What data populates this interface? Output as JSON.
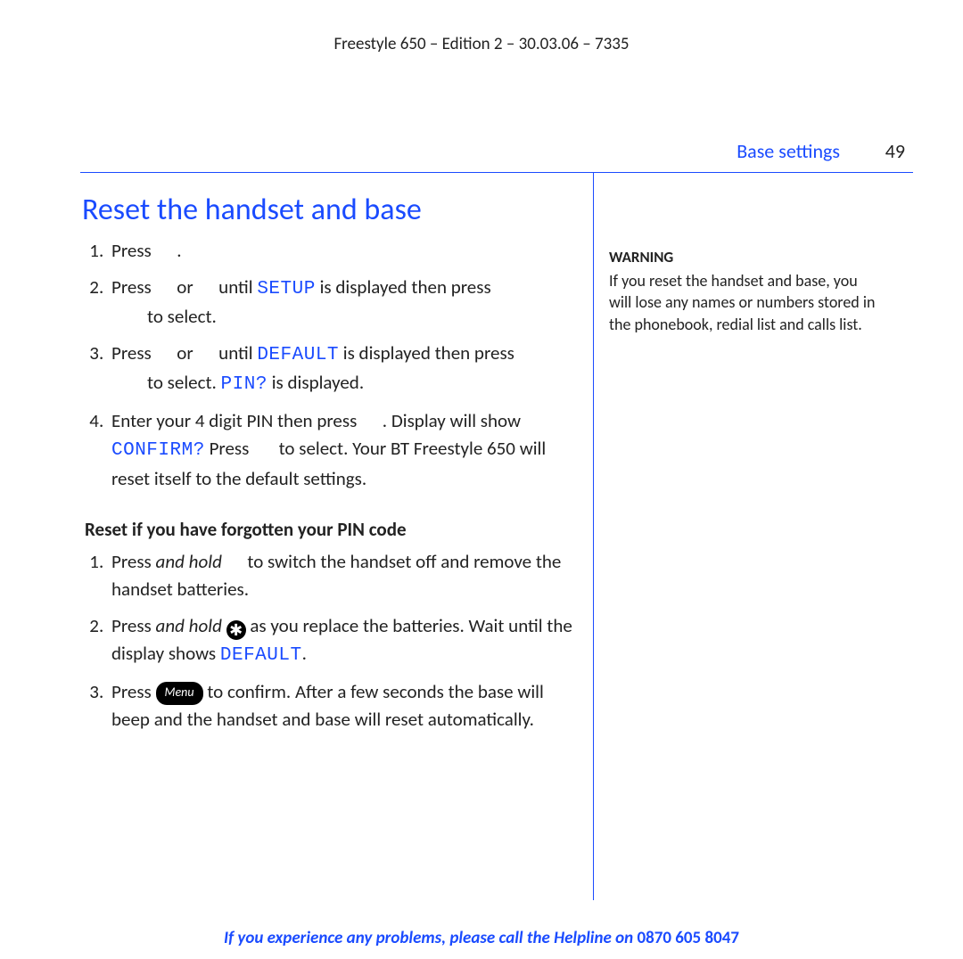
{
  "header_meta": "Freestyle 650 – Edition 2 – 30.03.06 – 7335",
  "section_label": "Base settings",
  "page_number": "49",
  "title": "Reset the handset and base",
  "steps_a": {
    "s1": {
      "a": "Press ",
      "b": "."
    },
    "s2": {
      "a": "Press ",
      "b": " or ",
      "c": " until ",
      "lcd": "SETUP",
      "d": " is displayed then press",
      "e": "to select."
    },
    "s3": {
      "a": "Press ",
      "b": " or ",
      "c": " until ",
      "lcd1": "DEFAULT",
      "d": " is displayed then press",
      "e": "to select. ",
      "lcd2": "PIN?",
      "f": " is displayed."
    },
    "s4": {
      "a": "Enter your 4 digit PIN then press ",
      "b": ". Display will show ",
      "lcd": "CONFIRM?",
      "c": " Press ",
      "d": " to select. Your BT Freestyle 650 will reset itself to the default settings."
    }
  },
  "subhead": "Reset if you have forgotten your PIN code",
  "steps_b": {
    "s1": {
      "a": "Press ",
      "ital": "and hold",
      "b": " to switch the handset off and remove the handset batteries."
    },
    "s2": {
      "a": "Press ",
      "ital": "and hold",
      "b": " as you replace the batteries. Wait until the display shows ",
      "lcd": "DEFAULT",
      "c": "."
    },
    "s3": {
      "a": "Press ",
      "b": " to confirm. After a few seconds the base will beep and the handset and base will reset automatically."
    }
  },
  "icons": {
    "star": "✱",
    "menu": "Menu"
  },
  "sidebar": {
    "head": "WARNING",
    "body": "If you reset the handset and base, you will lose any names or numbers stored in the phonebook, redial list and calls list."
  },
  "footer": {
    "a": "If you experience any problems, please call the Helpline on ",
    "b": "0870 605 8047"
  }
}
